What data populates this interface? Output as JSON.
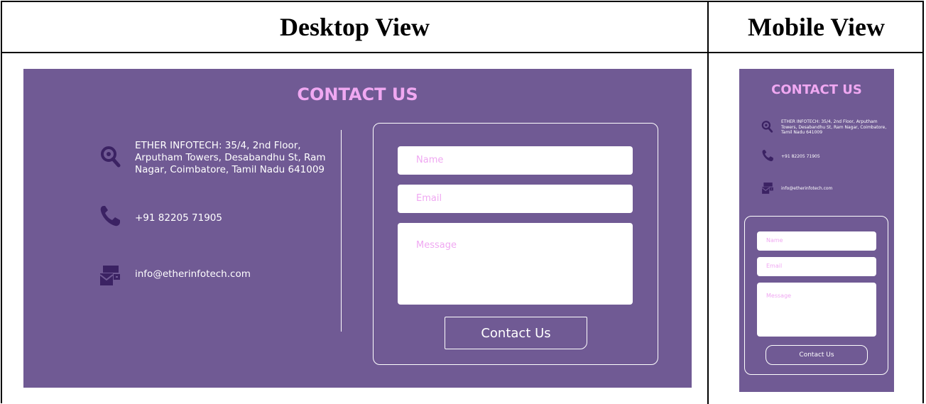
{
  "headers": {
    "desktop": "Desktop View",
    "mobile": "Mobile View"
  },
  "contact": {
    "title": "CONTACT US",
    "address": "ETHER INFOTECH: 35/4, 2nd Floor, Arputham Towers, Desabandhu St, Ram Nagar, Coimbatore, Tamil Nadu 641009",
    "phone": "+91 82205 71905",
    "email": "info@etherinfotech.com",
    "icons": {
      "address": "location-search-icon",
      "phone": "phone-icon",
      "email": "mail-icon"
    }
  },
  "form": {
    "name_placeholder": "Name",
    "email_placeholder": "Email",
    "message_placeholder": "Message",
    "submit_label": "Contact Us"
  },
  "colors": {
    "panel": "#705a94",
    "accent": "#f0a8f2",
    "icon": "#3b2263",
    "text": "#ffffff"
  }
}
